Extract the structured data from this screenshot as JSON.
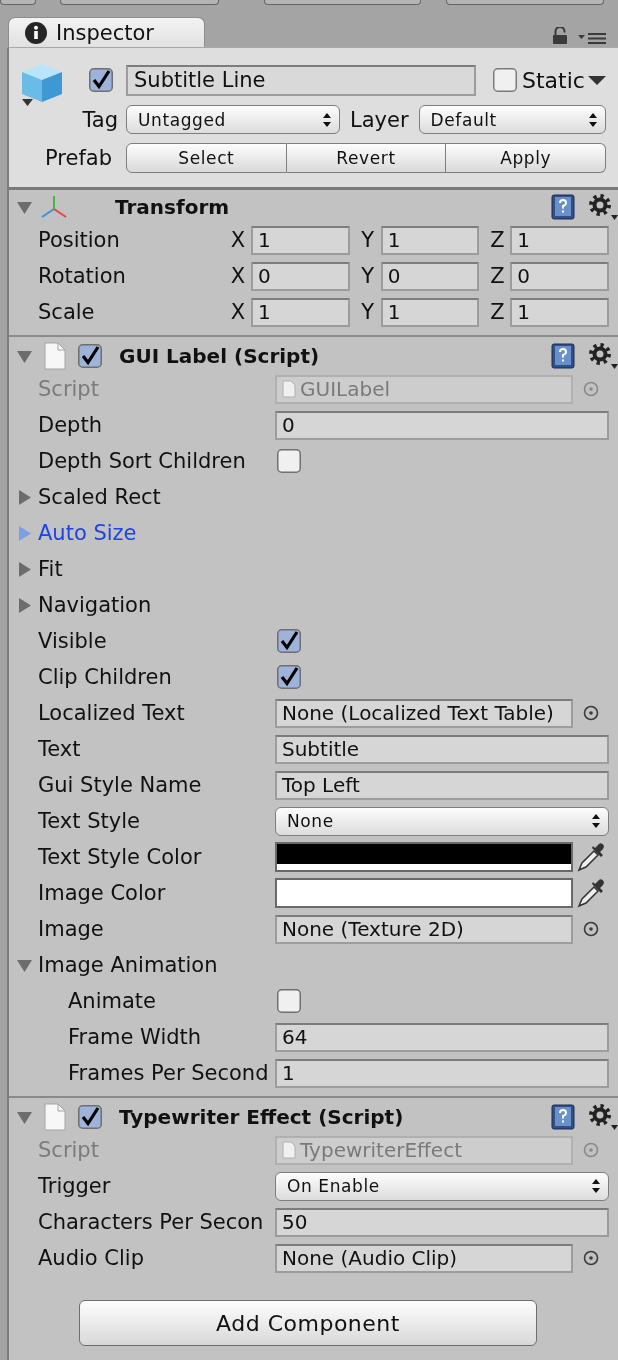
{
  "tabs": [
    {
      "label": "Inspector",
      "selected": true
    }
  ],
  "header": {
    "active": true,
    "name": "Subtitle Line",
    "static": {
      "label": "Static",
      "checked": false
    },
    "tag": {
      "label": "Tag",
      "value": "Untagged"
    },
    "layer": {
      "label": "Layer",
      "value": "Default"
    },
    "prefab": {
      "label": "Prefab",
      "buttons": [
        "Select",
        "Revert",
        "Apply"
      ]
    }
  },
  "components": [
    {
      "kind": "transform",
      "title": "Transform",
      "expanded": true,
      "rows": [
        {
          "label": "Position",
          "axes": [
            {
              "axis": "X",
              "value": "1"
            },
            {
              "axis": "Y",
              "value": "1"
            },
            {
              "axis": "Z",
              "value": "1"
            }
          ]
        },
        {
          "label": "Rotation",
          "axes": [
            {
              "axis": "X",
              "value": "0"
            },
            {
              "axis": "Y",
              "value": "0"
            },
            {
              "axis": "Z",
              "value": "0"
            }
          ]
        },
        {
          "label": "Scale",
          "axes": [
            {
              "axis": "X",
              "value": "1"
            },
            {
              "axis": "Y",
              "value": "1"
            },
            {
              "axis": "Z",
              "value": "1"
            }
          ]
        }
      ]
    },
    {
      "kind": "script",
      "title": "GUI Label (Script)",
      "expanded": true,
      "enabled": true,
      "fields": [
        {
          "kind": "script",
          "label": "Script",
          "value": "GUILabel"
        },
        {
          "kind": "text",
          "label": "Depth",
          "value": "0"
        },
        {
          "kind": "toggle",
          "label": "Depth Sort Children",
          "checked": false
        },
        {
          "kind": "foldout",
          "label": "Scaled Rect",
          "expanded": false,
          "selected": false
        },
        {
          "kind": "foldout",
          "label": "Auto Size",
          "expanded": false,
          "selected": true
        },
        {
          "kind": "foldout",
          "label": "Fit",
          "expanded": false,
          "selected": false
        },
        {
          "kind": "foldout",
          "label": "Navigation",
          "expanded": false,
          "selected": false
        },
        {
          "kind": "toggle",
          "label": "Visible",
          "checked": true
        },
        {
          "kind": "toggle",
          "label": "Clip Children",
          "checked": true
        },
        {
          "kind": "object",
          "label": "Localized Text",
          "value": "None (Localized Text Table)"
        },
        {
          "kind": "text",
          "label": "Text",
          "value": "Subtitle"
        },
        {
          "kind": "text",
          "label": "Gui Style Name",
          "value": "Top Left"
        },
        {
          "kind": "dropdown",
          "label": "Text Style",
          "value": "None"
        },
        {
          "kind": "color",
          "label": "Text Style Color",
          "color": "#000000"
        },
        {
          "kind": "color",
          "label": "Image Color",
          "color": "#ffffff"
        },
        {
          "kind": "object",
          "label": "Image",
          "value": "None (Texture 2D)"
        },
        {
          "kind": "foldout",
          "label": "Image Animation",
          "expanded": true,
          "selected": false,
          "children": [
            {
              "kind": "toggle",
              "label": "Animate",
              "checked": false
            },
            {
              "kind": "text",
              "label": "Frame Width",
              "value": "64"
            },
            {
              "kind": "text",
              "label": "Frames Per Second",
              "value": "1"
            }
          ]
        }
      ]
    },
    {
      "kind": "script",
      "title": "Typewriter Effect (Script)",
      "expanded": true,
      "enabled": true,
      "fields": [
        {
          "kind": "script",
          "label": "Script",
          "value": "TypewriterEffect"
        },
        {
          "kind": "dropdown",
          "label": "Trigger",
          "value": "On Enable"
        },
        {
          "kind": "text",
          "label": "Characters Per Secon",
          "value": "50"
        },
        {
          "kind": "object",
          "label": "Audio Clip",
          "value": "None (Audio Clip)"
        }
      ]
    }
  ],
  "add_button": "Add Component"
}
